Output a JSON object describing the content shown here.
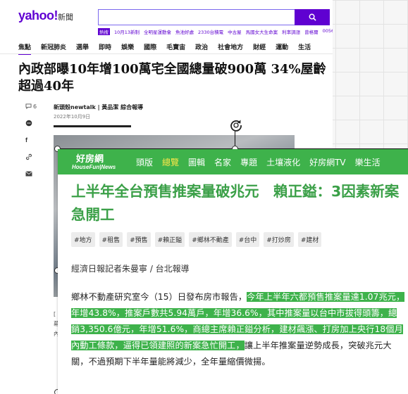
{
  "yahoo": {
    "logo": "yahoo!",
    "logo_sub": "新聞",
    "search_placeholder": "",
    "trending": [
      "熱搜",
      "10月13新制",
      "全明星運動會",
      "魚池好處",
      "2330台積電",
      "中古屋",
      "馬國女大生命案",
      "利率調漲",
      "曾格爾",
      "0056"
    ],
    "nav": [
      "焦點",
      "新冠肺炎",
      "選舉",
      "即時",
      "娛樂",
      "國際",
      "毛寶宙",
      "政治",
      "社會地方",
      "財經",
      "運動",
      "生活"
    ],
    "title": "內政部曝10年增100萬宅全國總量破900萬 34%屋齡超過40年",
    "comment_count": "6",
    "source": "新頭殼newtalk | 黃品潔 綜合報導",
    "date": "2022年10月9日",
    "caption_lines": [
      "[",
      "幕",
      "內"
    ]
  },
  "housefun": {
    "logo_main": "好房網",
    "logo_sub": "HouseFun",
    "logo_news": "News",
    "nav": [
      "頭版",
      "總覽",
      "圖輯",
      "名家",
      "專題",
      "土壤液化",
      "好房網TV",
      "樂生活"
    ],
    "active_nav": "總覽",
    "title": "上半年全台預售推案量破兆元　賴正鎰：3因素新案急開工",
    "tags": [
      "#地方",
      "#租售",
      "#預售",
      "#賴正鎰",
      "#鄉林不動產",
      "#台中",
      "#打炒房",
      "#建材"
    ],
    "byline": "經濟日報記者朱曼寧 / 台北報導",
    "body_lead": "鄉林不動產研究室今（15）日發布房市報告，",
    "body_highlight": "今年上半年六都預售推案量達1.07兆元，年增43.8%，推案戶數共5.94萬戶，年增36.6%，其中推案量以台中市拔得頭籌，總銷3,350.6億元，年增51.6%，商總主席賴正鎰分析，建材飆漲、打房加上央行18個月內動工條款，逼得已領建照的新案急忙開工，",
    "body_tail": "讓上半年推案量逆勢成長，突破兆元大關，不過預期下半年量能將減少，全年量縮價微揚。"
  },
  "colors": {
    "yahoo_purple": "#6001d2",
    "housefun_green": "#3eb24b",
    "highlight_green": "#3eb24b"
  }
}
